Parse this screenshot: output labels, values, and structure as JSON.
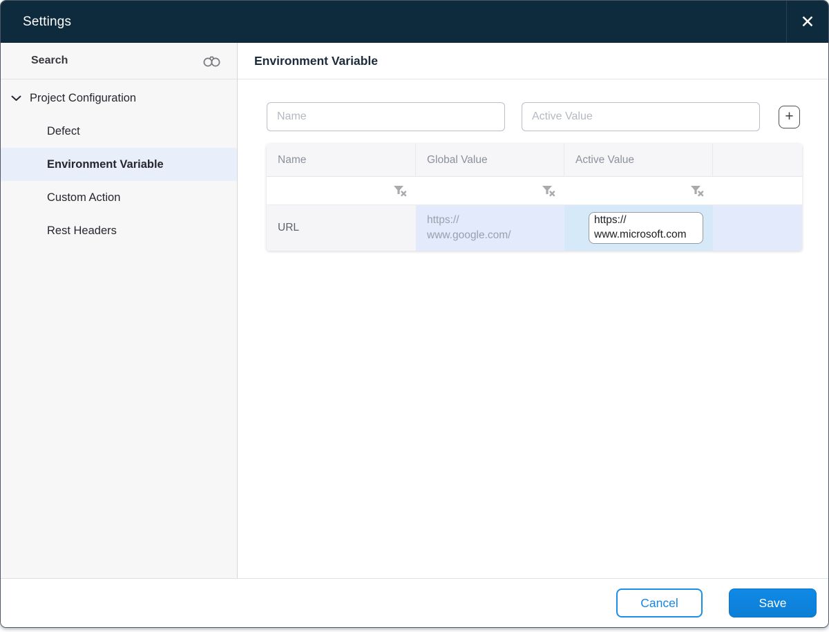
{
  "dialog": {
    "title": "Settings",
    "close_icon": "✕"
  },
  "sidebar": {
    "search": {
      "label": "Search",
      "icon": "binoculars-icon"
    },
    "tree": {
      "parent_label": "Project Configuration",
      "parent_expanded": true,
      "items": [
        {
          "label": "Defect",
          "selected": false
        },
        {
          "label": "Environment Variable",
          "selected": true
        },
        {
          "label": "Custom Action",
          "selected": false
        },
        {
          "label": "Rest Headers",
          "selected": false
        }
      ]
    }
  },
  "main": {
    "heading": "Environment Variable",
    "form": {
      "name_placeholder": "Name",
      "active_value_placeholder": "Active Value",
      "add_button_label": "+"
    },
    "table": {
      "columns": [
        "Name",
        "Global Value",
        "Active Value",
        ""
      ],
      "filter_icon": "filter-clear-icon",
      "rows": [
        {
          "name": "URL",
          "global_value": "https://www.google.com/",
          "active_value": "https://www.microsoft.com"
        }
      ]
    }
  },
  "footer": {
    "cancel_label": "Cancel",
    "save_label": "Save"
  },
  "colors": {
    "titlebar_bg": "#0e2a3d",
    "accent_blue": "#0d86e0",
    "selected_item_bg": "#e9eefb",
    "row_highlight": "#e2eafc",
    "active_cell_highlight": "#d5e9f9"
  }
}
